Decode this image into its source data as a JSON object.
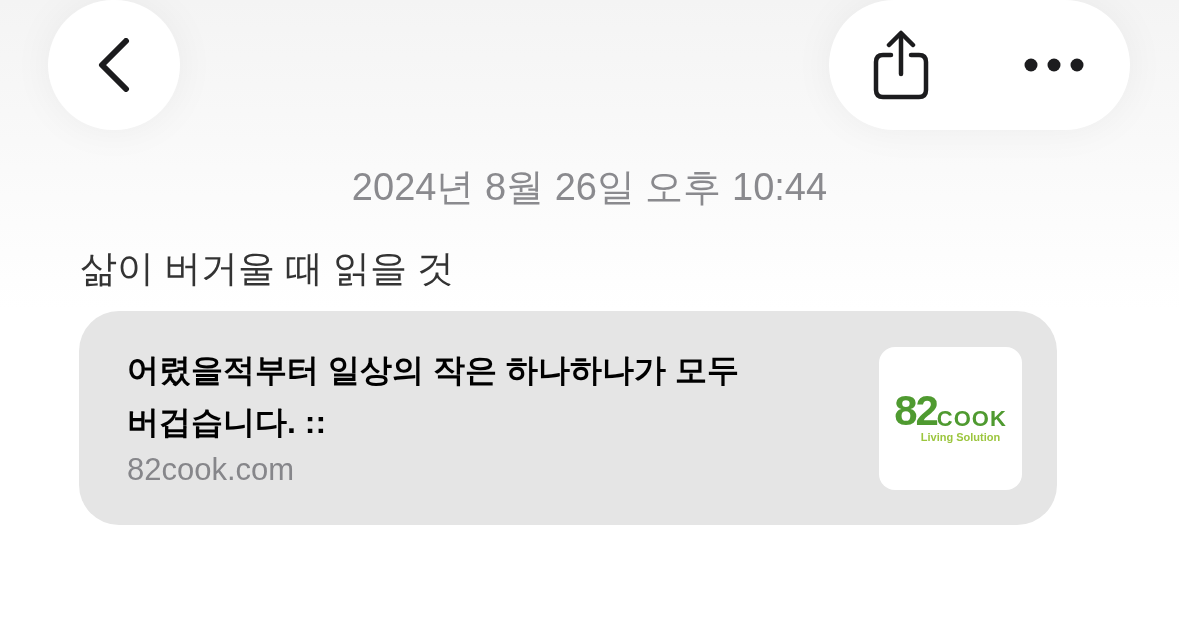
{
  "message": {
    "timestamp": "2024년 8월 26일 오후 10:44",
    "text": "삶이 버거울 때 읽을 것",
    "link_preview": {
      "title": "어렸을적부터 일상의 작은 하나하나가 모두 버겁습니다. ::",
      "domain": "82cook.com",
      "thumbnail": {
        "logo_number": "82",
        "logo_word": "COOK",
        "tagline": "Living Solution"
      }
    }
  }
}
